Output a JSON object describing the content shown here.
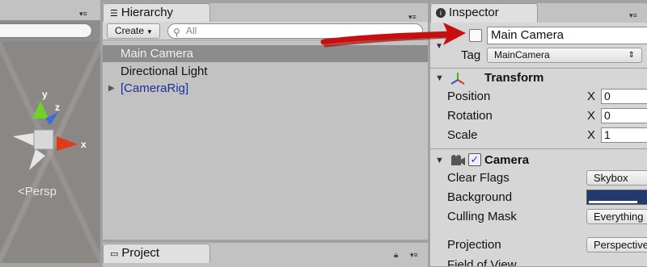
{
  "scene": {
    "axis_y": "y",
    "axis_z": "z",
    "axis_x": "x",
    "persp_label": "Persp",
    "persp_icon": "<"
  },
  "hierarchy": {
    "tab_title": "Hierarchy",
    "create_label": "Create",
    "search_placeholder": "All",
    "items": [
      {
        "label": "Main Camera",
        "selected": true
      },
      {
        "label": "Directional Light",
        "selected": false
      },
      {
        "label": "[CameraRig]",
        "selected": false,
        "expandable": true
      }
    ]
  },
  "project": {
    "tab_title": "Project"
  },
  "inspector": {
    "tab_title": "Inspector",
    "object_name": "Main Camera",
    "tag_label": "Tag",
    "tag_value": "MainCamera",
    "transform": {
      "title": "Transform",
      "rows": [
        {
          "label": "Position",
          "axis": "X",
          "value": "0"
        },
        {
          "label": "Rotation",
          "axis": "X",
          "value": "0"
        },
        {
          "label": "Scale",
          "axis": "X",
          "value": "1"
        }
      ]
    },
    "camera": {
      "title": "Camera",
      "enabled": true,
      "check_glyph": "✓",
      "clear_flags_label": "Clear Flags",
      "clear_flags_value": "Skybox",
      "background_label": "Background",
      "background_color": "#233a6e",
      "culling_label": "Culling Mask",
      "culling_value": "Everything",
      "projection_label": "Projection",
      "projection_value": "Perspective",
      "fov_label": "Field of View"
    }
  },
  "colors": {
    "annotation_red": "#d11212",
    "selection_row": "#8c8c8c",
    "prefab_text": "#1d2f9b"
  }
}
